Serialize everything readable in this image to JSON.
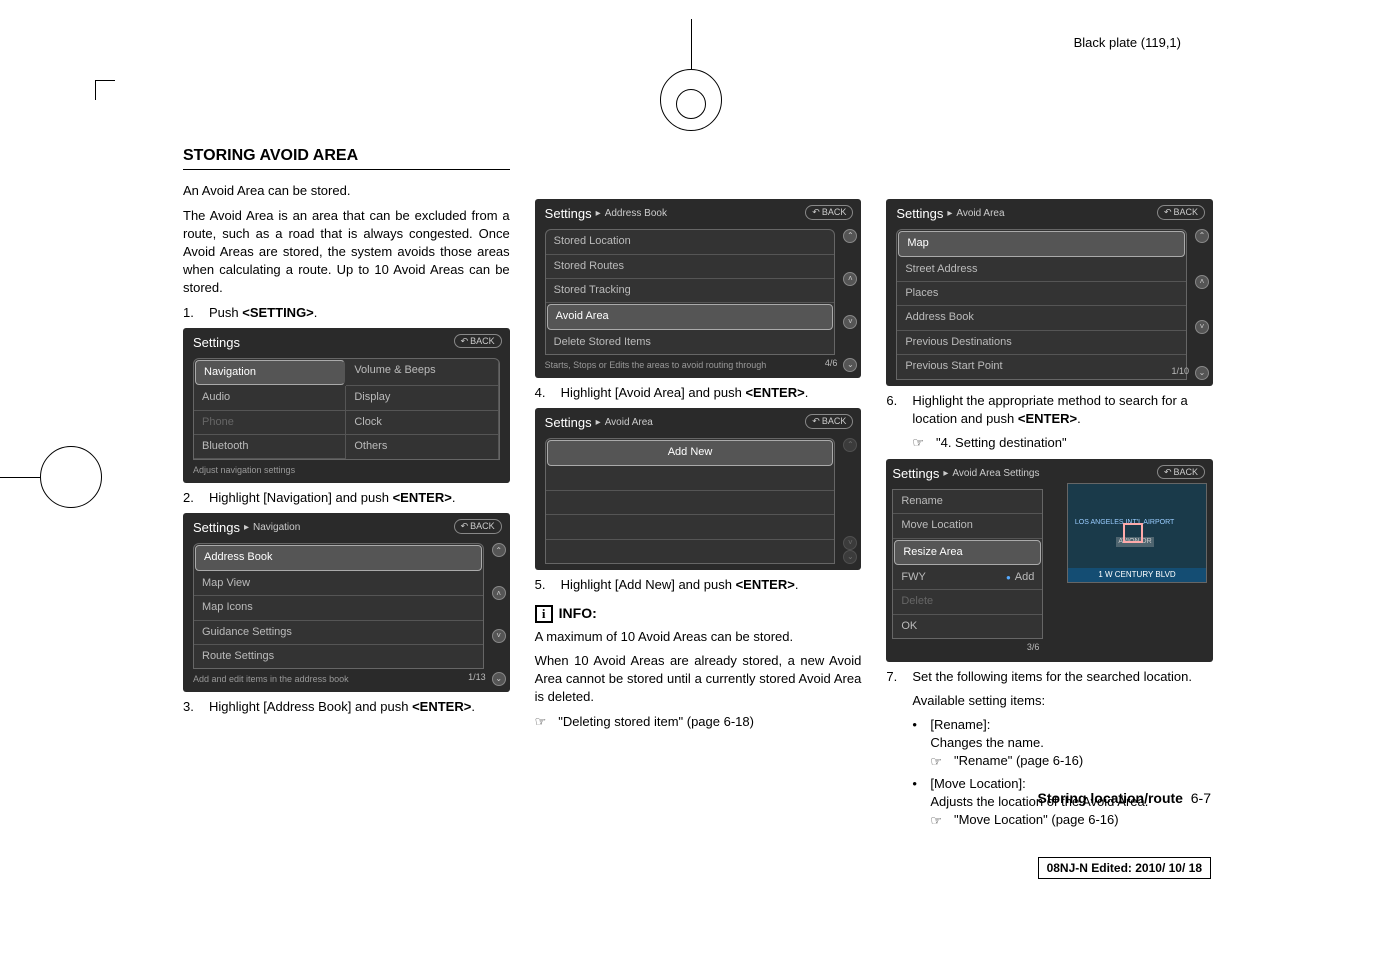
{
  "meta": {
    "plate": "Black plate (119,1)",
    "stamp": "08NJ-N Edited:  2010/ 10/ 18"
  },
  "heading": "STORING AVOID AREA",
  "intro1": "An Avoid Area can be stored.",
  "intro2": "The Avoid Area is an area that can be excluded from a route, such as a road that is always congested. Once Avoid Areas are stored, the system avoids those areas when calculating a route. Up to 10 Avoid Areas can be stored.",
  "steps": {
    "s1": {
      "num": "1.",
      "text": "Push <SETTING>."
    },
    "s2": {
      "num": "2.",
      "text": "Highlight [Navigation] and push <ENTER>."
    },
    "s3": {
      "num": "3.",
      "text": "Highlight [Address Book] and push <ENTER>."
    },
    "s4": {
      "num": "4.",
      "text": "Highlight [Avoid Area] and push <ENTER>."
    },
    "s5": {
      "num": "5.",
      "text": "Highlight [Add New] and push <ENTER>."
    },
    "s6": {
      "num": "6.",
      "text": "Highlight the appropriate method to search for a location and push <ENTER>."
    },
    "s6ref": "\"4. Setting destination\"",
    "s7": {
      "num": "7.",
      "text": "Set the following items for the searched location."
    },
    "avail": "Available setting items:"
  },
  "info": {
    "label": "INFO:",
    "body1": "A maximum of 10 Avoid Areas can be stored.",
    "body2": "When 10 Avoid Areas are already stored, a new Avoid Area cannot be stored until a currently stored Avoid Area is deleted.",
    "ref": "\"Deleting stored item\" (page 6-18)"
  },
  "items": {
    "rename": {
      "label": "[Rename]:",
      "desc": "Changes the name.",
      "ref": "\"Rename\" (page 6-16)"
    },
    "move": {
      "label": "[Move Location]:",
      "desc": "Adjusts the location of the Avoid Area.",
      "ref": "\"Move Location\" (page 6-16)"
    }
  },
  "footer": {
    "label": "Storing location/route",
    "page": "6-7"
  },
  "screens": {
    "back": "BACK",
    "settings1": {
      "title": "Settings",
      "rows": [
        [
          "Navigation",
          "Volume & Beeps"
        ],
        [
          "Audio",
          "Display"
        ],
        [
          "Phone",
          "Clock"
        ],
        [
          "Bluetooth",
          "Others"
        ]
      ],
      "footer": "Adjust navigation settings"
    },
    "nav": {
      "title": "Settings",
      "crumb": "Navigation",
      "rows": [
        "Address Book",
        "Map View",
        "Map Icons",
        "Guidance Settings",
        "Route Settings"
      ],
      "footer": "Add and edit items in the address book",
      "page": "1/13"
    },
    "addr": {
      "title": "Settings",
      "crumb": "Address Book",
      "rows": [
        "Stored Location",
        "Stored Routes",
        "Stored Tracking",
        "Avoid Area",
        "Delete Stored Items"
      ],
      "footer": "Starts, Stops or Edits the areas to avoid routing through",
      "page": "4/6"
    },
    "avoid": {
      "title": "Settings",
      "crumb": "Avoid Area",
      "rows": [
        "Add New"
      ]
    },
    "avoidloc": {
      "title": "Settings",
      "crumb": "Avoid Area",
      "rows": [
        "Map",
        "Street Address",
        "Places",
        "Address Book",
        "Previous Destinations",
        "Previous Start Point"
      ],
      "page": "1/10"
    },
    "avoidset": {
      "title": "Settings",
      "crumb": "Avoid Area Settings",
      "rows": [
        "Rename",
        "Move Location",
        "Resize Area",
        "FWY",
        "Delete",
        "OK"
      ],
      "fwy": "Add",
      "page": "3/6",
      "map_label": "1  W CENTURY BLVD",
      "map_text1": "LOS ANGELES INT'L AIRPORT",
      "map_text2": "AVION DR"
    }
  }
}
